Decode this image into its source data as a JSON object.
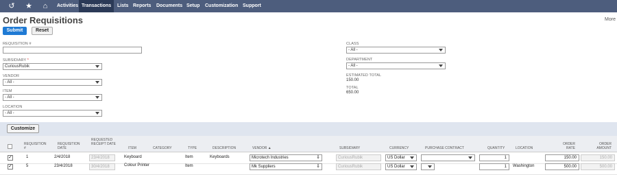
{
  "nav": {
    "items": [
      "Activities",
      "Transactions",
      "Lists",
      "Reports",
      "Documents",
      "Setup",
      "Customization",
      "Support"
    ],
    "active": "Transactions"
  },
  "page": {
    "title": "Order Requisitions",
    "more": "More"
  },
  "buttons": {
    "submit": "Submit",
    "reset": "Reset",
    "customize": "Customize"
  },
  "filters": {
    "requisition_label": "REQUISITION #",
    "requisition_value": "",
    "subsidiary_label": "SUBSIDIARY",
    "subsidiary_required": "*",
    "subsidiary_value": "CuriousRubik",
    "vendor_label": "VENDOR",
    "vendor_value": "- All -",
    "item_label": "ITEM",
    "item_value": "- All -",
    "location_label": "LOCATION",
    "location_value": "- All -",
    "class_label": "CLASS",
    "class_value": "- All -",
    "department_label": "DEPARTMENT",
    "department_value": "- All -",
    "est_total_label": "ESTIMATED TOTAL",
    "est_total_value": "150.00",
    "total_label": "TOTAL",
    "total_value": "650.00"
  },
  "table": {
    "headers": {
      "requisition": "REQUISITION #",
      "req_date": "REQUISITION DATE",
      "receipt_date": "REQUESTED RECEIPT DATE",
      "item": "ITEM",
      "category": "CATEGORY",
      "type": "TYPE",
      "description": "DESCRIPTION",
      "vendor": "VENDOR ▲",
      "subsidiary": "SUBSIDIARY",
      "currency": "CURRENCY",
      "contract": "PURCHASE CONTRACT",
      "quantity": "QUANTITY",
      "location": "LOCATION",
      "order_rate": "ORDER RATE",
      "order_amount": "ORDER AMOUNT"
    },
    "rows": [
      {
        "checked": true,
        "requisition": "1",
        "req_date": "2/4/2018",
        "receipt_date": "23/4/2018",
        "item": "Keyboard",
        "category": "",
        "type": "Item",
        "description": "Keyboards",
        "vendor": "Microtech Industries",
        "subsidiary": "CuriousRubik",
        "currency": "US Dollar",
        "contract": "",
        "quantity": "1",
        "location": "",
        "order_rate": "150.00",
        "order_amount": "150.00"
      },
      {
        "checked": true,
        "requisition": "5",
        "req_date": "23/4/2018",
        "receipt_date": "30/4/2018",
        "item": "Colour Printer",
        "category": "",
        "type": "Item",
        "description": "",
        "vendor": "Mk Suppliers",
        "subsidiary": "CuriousRubik",
        "currency": "US Dollar",
        "contract": "",
        "quantity": "1",
        "location": "Washington",
        "order_rate": "500.00",
        "order_amount": "500.00"
      }
    ]
  }
}
